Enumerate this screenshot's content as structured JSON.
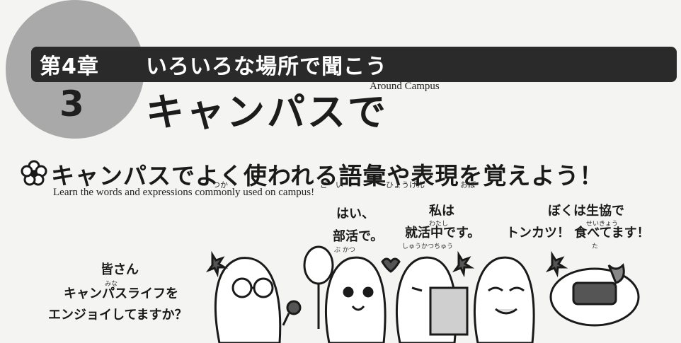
{
  "header": {
    "chapter_label": "第4章",
    "chapter_title": "いろいろな場所で聞こう",
    "lesson_number": "3",
    "lesson_title": "キャンパスで",
    "lesson_subtitle": "Around Campus"
  },
  "section": {
    "heading": "キャンパスでよく使われる語彙や表現を覚えよう！",
    "ruby": [
      "つか",
      "ご　い",
      "ひょうげん",
      "おぼ"
    ],
    "subtitle": "Learn the words and expressions commonly used on campus!"
  },
  "speech": {
    "intro_line1": "皆さん",
    "intro_ruby": "みな",
    "intro_line2": "キャンパスライフを",
    "intro_line3": "エンジョイしてますか？",
    "club_line1": "はい、",
    "club_line2": "部活で。",
    "club_ruby": "ぶ かつ",
    "job_line1": "私は",
    "job_ruby1": "わたし",
    "job_line2": "就活中です。",
    "job_ruby2": "しゅうかつちゅう",
    "coop_line1": "ぼくは生協で",
    "coop_ruby1": "せいきょう",
    "coop_line2": "トンカツ！ 食べてます！",
    "coop_ruby2": "た"
  },
  "colors": {
    "circle": "#a9a9a9",
    "bar": "#2a2a2a",
    "background": "#f4f4f2"
  },
  "icons": [
    "flower-icon",
    "cartoon-characters-illustration"
  ]
}
